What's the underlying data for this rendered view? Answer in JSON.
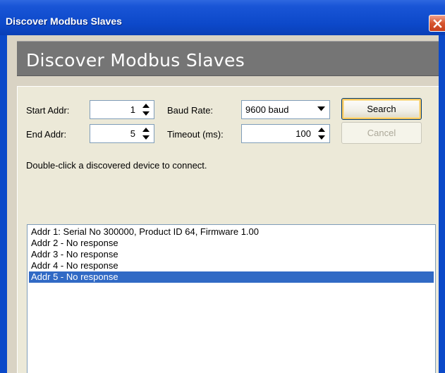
{
  "window": {
    "title": "Discover Modbus Slaves",
    "close_icon": "close-icon"
  },
  "header": {
    "title": "Discover Modbus Slaves"
  },
  "form": {
    "start_addr_label": "Start Addr:",
    "start_addr_value": "1",
    "end_addr_label": "End Addr:",
    "end_addr_value": "5",
    "baud_rate_label": "Baud Rate:",
    "baud_rate_value": "9600 baud",
    "timeout_label": "Timeout (ms):",
    "timeout_value": "100"
  },
  "buttons": {
    "search_label": "Search",
    "cancel_label": "Cancel"
  },
  "instructions": "Double-click a discovered device to connect.",
  "results": {
    "items": [
      "Addr 1: Serial No 300000, Product ID 64, Firmware 1.00",
      "Addr 2 - No response",
      "Addr 3 - No response",
      "Addr 4 - No response",
      "Addr 5 - No response"
    ],
    "selected_index": 4
  },
  "colors": {
    "titlebar": "#0c48c9",
    "header_band": "#757575",
    "selection": "#316ac5",
    "close_button": "#d6552f"
  }
}
